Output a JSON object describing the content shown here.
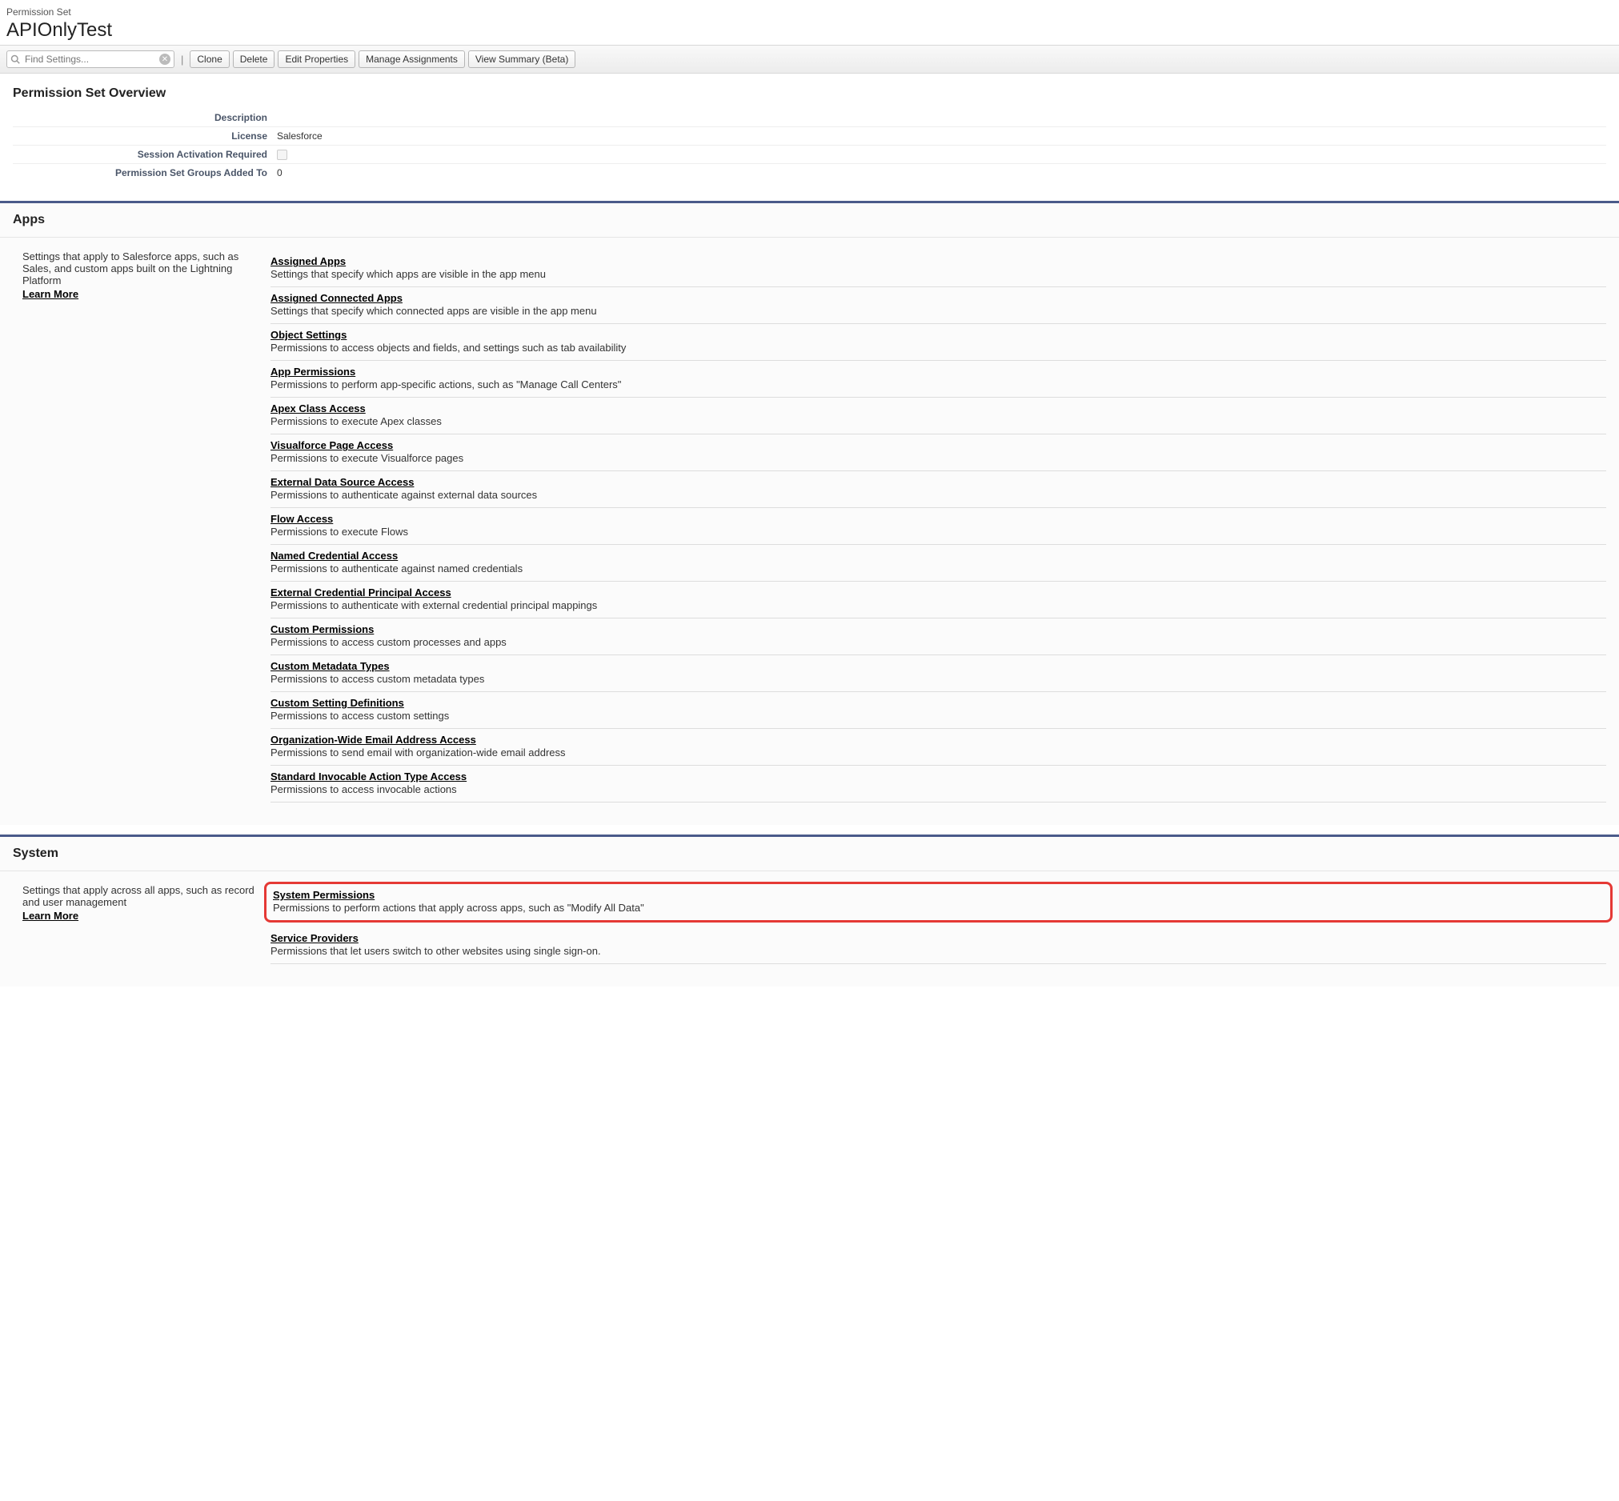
{
  "header": {
    "label": "Permission Set",
    "title": "APIOnlyTest"
  },
  "toolbar": {
    "search_placeholder": "Find Settings...",
    "clone": "Clone",
    "delete": "Delete",
    "edit_properties": "Edit Properties",
    "manage_assignments": "Manage Assignments",
    "view_summary": "View Summary (Beta)"
  },
  "overview": {
    "title": "Permission Set Overview",
    "rows": {
      "description_label": "Description",
      "description_value": "",
      "license_label": "License",
      "license_value": "Salesforce",
      "session_label": "Session Activation Required",
      "groups_label": "Permission Set Groups Added To",
      "groups_value": "0"
    }
  },
  "apps": {
    "title": "Apps",
    "intro": "Settings that apply to Salesforce apps, such as Sales, and custom apps built on the Lightning Platform",
    "learn_more": "Learn More",
    "items": [
      {
        "title": "Assigned Apps",
        "desc": "Settings that specify which apps are visible in the app menu"
      },
      {
        "title": "Assigned Connected Apps",
        "desc": "Settings that specify which connected apps are visible in the app menu"
      },
      {
        "title": "Object Settings",
        "desc": "Permissions to access objects and fields, and settings such as tab availability"
      },
      {
        "title": "App Permissions",
        "desc": "Permissions to perform app-specific actions, such as \"Manage Call Centers\""
      },
      {
        "title": "Apex Class Access",
        "desc": "Permissions to execute Apex classes"
      },
      {
        "title": "Visualforce Page Access",
        "desc": "Permissions to execute Visualforce pages"
      },
      {
        "title": "External Data Source Access",
        "desc": "Permissions to authenticate against external data sources"
      },
      {
        "title": "Flow Access",
        "desc": "Permissions to execute Flows"
      },
      {
        "title": "Named Credential Access",
        "desc": "Permissions to authenticate against named credentials"
      },
      {
        "title": "External Credential Principal Access",
        "desc": "Permissions to authenticate with external credential principal mappings"
      },
      {
        "title": "Custom Permissions",
        "desc": "Permissions to access custom processes and apps"
      },
      {
        "title": "Custom Metadata Types",
        "desc": "Permissions to access custom metadata types"
      },
      {
        "title": "Custom Setting Definitions",
        "desc": "Permissions to access custom settings"
      },
      {
        "title": "Organization-Wide Email Address Access",
        "desc": "Permissions to send email with organization-wide email address"
      },
      {
        "title": "Standard Invocable Action Type Access",
        "desc": "Permissions to access invocable actions"
      }
    ]
  },
  "system": {
    "title": "System",
    "intro": "Settings that apply across all apps, such as record and user management",
    "learn_more": "Learn More",
    "items": [
      {
        "title": "System Permissions",
        "desc": "Permissions to perform actions that apply across apps, such as \"Modify All Data\"",
        "highlight": true
      },
      {
        "title": "Service Providers",
        "desc": "Permissions that let users switch to other websites using single sign-on."
      }
    ]
  }
}
